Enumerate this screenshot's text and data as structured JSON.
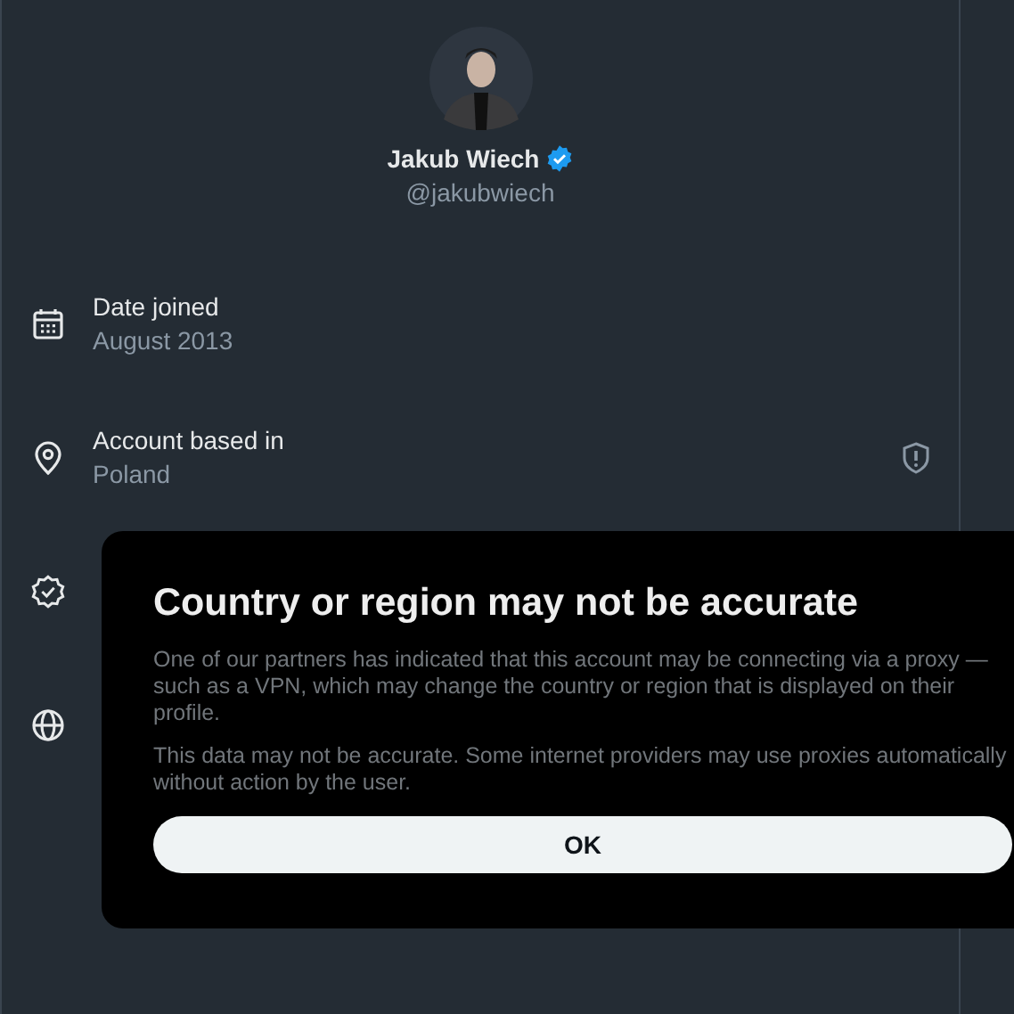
{
  "profile": {
    "name": "Jakub Wiech",
    "verified": true,
    "handle": "@jakubwiech"
  },
  "details": [
    {
      "kind": "calendar",
      "label": "Date joined",
      "value": "August 2013",
      "flag": false
    },
    {
      "kind": "location",
      "label": "Account based in",
      "value": "Poland",
      "flag": true
    },
    {
      "kind": "verified",
      "flag": false
    },
    {
      "kind": "globe",
      "flag": false
    }
  ],
  "dialog": {
    "title": "Country or region may not be accurate",
    "paragraphs": [
      "One of our partners has indicated that this account may be connecting via a proxy — such as a VPN, which may change the country or region that is displayed on their profile.",
      "This data may not be accurate. Some internet providers may use proxies automatically without action by the user."
    ],
    "button": "OK"
  }
}
